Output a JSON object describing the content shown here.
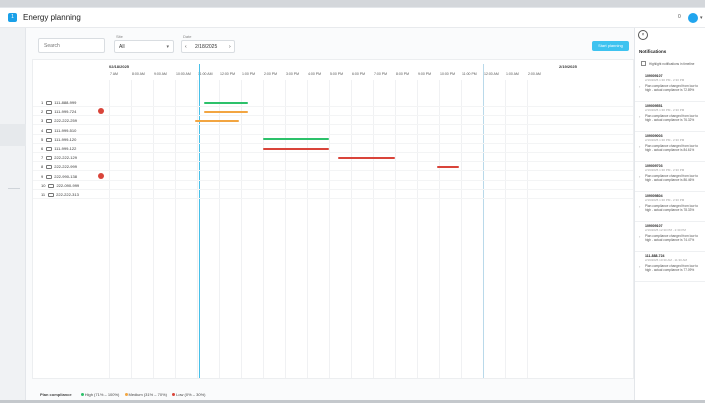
{
  "app": {
    "title": "Energy planning",
    "logo": "1",
    "notification_count": "0"
  },
  "toolbar": {
    "search_placeholder": "Search",
    "site_label": "Site",
    "site_value": "All",
    "date_label": "Date",
    "date_value": "2/18/2025",
    "start_button": "Start planning"
  },
  "gantt": {
    "dates": [
      "02/18/2025",
      "2/19/2025"
    ],
    "hours": [
      "7 AM",
      "8:00 AM",
      "9:00 AM",
      "10:00 AM",
      "11:00 AM",
      "12:00 PM",
      "1:00 PM",
      "2:00 PM",
      "3:00 PM",
      "4:00 PM",
      "5:00 PM",
      "6:00 PM",
      "7:00 PM",
      "8:00 PM",
      "9:00 PM",
      "10:00 PM",
      "11:00 PM",
      "12:00 AM",
      "1:00 AM",
      "2:00 AM"
    ],
    "rows": [
      {
        "index": "1",
        "name": "111-888-999",
        "alert": false,
        "bar": {
          "start": 11.3,
          "end": 13.3,
          "level": "high"
        }
      },
      {
        "index": "2",
        "name": "111-999-724",
        "alert": true,
        "bar": {
          "start": 11.3,
          "end": 13.3,
          "level": "medium"
        }
      },
      {
        "index": "3",
        "name": "222-222-259",
        "alert": false,
        "bar": {
          "start": 10.9,
          "end": 12.9,
          "level": "medium"
        }
      },
      {
        "index": "4",
        "name": "111-999-510",
        "alert": false,
        "bar": null
      },
      {
        "index": "5",
        "name": "111-999-120",
        "alert": false,
        "bar": {
          "start": 14.0,
          "end": 17.0,
          "level": "high"
        }
      },
      {
        "index": "6",
        "name": "111-999-122",
        "alert": false,
        "bar": {
          "start": 14.0,
          "end": 17.0,
          "level": "low"
        }
      },
      {
        "index": "7",
        "name": "222-222-129",
        "alert": false,
        "bar": {
          "start": 17.4,
          "end": 20.0,
          "level": "low"
        }
      },
      {
        "index": "8",
        "name": "222-222-999",
        "alert": false,
        "bar": {
          "start": 21.9,
          "end": 22.9,
          "level": "low"
        }
      },
      {
        "index": "9",
        "name": "222-990-138",
        "alert": true,
        "bar": null
      },
      {
        "index": "10",
        "name": "222-090-999",
        "alert": false,
        "bar": null
      },
      {
        "index": "11",
        "name": "222-222-313",
        "alert": false,
        "bar": null
      }
    ]
  },
  "colors": {
    "high": "#2cc16a",
    "medium": "#f2a541",
    "low": "#d9443a",
    "accent": "#3ec3f0"
  },
  "legend": {
    "title": "Plan compliance",
    "items": [
      {
        "label": "High (71% – 100%)",
        "level": "high"
      },
      {
        "label": "Medium (31% – 70%)",
        "level": "medium"
      },
      {
        "label": "Low (0% – 30%)",
        "level": "low"
      }
    ]
  },
  "notifications": {
    "title": "Notifications",
    "highlight_label": "Highlight notifications in timeline",
    "items": [
      {
        "id": "109009107",
        "time": "2/19/2025 1:30 PM - 2:30 PM",
        "message": "Plan compliance changed from low to high - actual compliance is 72.89%"
      },
      {
        "id": "109009551",
        "time": "2/19/2025 1:30 PM - 2:30 PM",
        "message": "Plan compliance changed from low to high - actual compliance is 76.32%"
      },
      {
        "id": "109009003",
        "time": "2/19/2025 1:30 PM - 2:30 PM",
        "message": "Plan compliance changed from low to high - actual compliance is 84.61%"
      },
      {
        "id": "109009703",
        "time": "2/19/2025 1:30 PM - 2:30 PM",
        "message": "Plan compliance changed from low to high - actual compliance is 86.46%"
      },
      {
        "id": "109009804",
        "time": "2/19/2025 1:30 PM - 2:30 PM",
        "message": "Plan compliance changed from low to high - actual compliance is 78.33%"
      },
      {
        "id": "109009107",
        "time": "2/19/2025 12:30 PM - 2:30 PM",
        "message": "Plan compliance changed from low to high - actual compliance is 74.47%"
      },
      {
        "id": "111-888-724",
        "time": "2/19/2025 10:30 AM - 11:30 AM",
        "message": "Plan compliance changed from low to high - actual compliance is 77.09%"
      }
    ]
  }
}
